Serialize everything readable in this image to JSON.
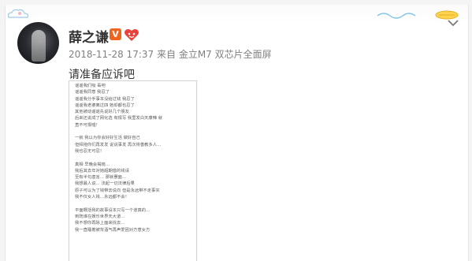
{
  "post": {
    "username": "薛之谦",
    "verified_badge": "V",
    "timestamp": "2018-11-28 17:37",
    "source_prefix": "来自",
    "source_device": "金立M7 双芯片全面屏",
    "text": "请准备应诉吧"
  },
  "icons": {
    "member": "heart-badge-icon",
    "menu": "chevron-down-icon",
    "decor": "cloud-icon"
  },
  "colors": {
    "verified": "#f0641e",
    "meta": "#808080",
    "member": "#e8423a"
  },
  "note_image": {
    "lines": [
      "谣谣我们吸 毒吧",
      "谣谣我同意 我忍了",
      "谣谣我分手事本没给过钱 我忍了",
      "谣谣我老婆离过四 她却都也忍了",
      "其他被动谣谣先说好几个朋友",
      "后来还说成了网化选 有报写 我里发白天康辣 就",
      "直不可报嘘！",
      "",
      "一就 我以为你会好好生活 做好自己",
      "但拜拖你们再发发 说说事发 再次将善教多人…",
      "我也忍无可忍！",
      "",
      "真相 早晚会揭晓…",
      "我后其去年对她超期借的钱请",
      "至有半句虚言… 那就罢面…",
      "我想最人说… 法起一切法律后果",
      "原子可以为了钱带去说向 但是永远带不走事实",
      "我不仅女人钱…永远都不会！",
      "",
      "平面概括我的故事设本只写一个道真的…",
      "到既谁在娱乐世界天大道…",
      "我不想你再除上面来找去…",
      "我一直睡着被背酒气再声爱团对方意女方"
    ]
  }
}
